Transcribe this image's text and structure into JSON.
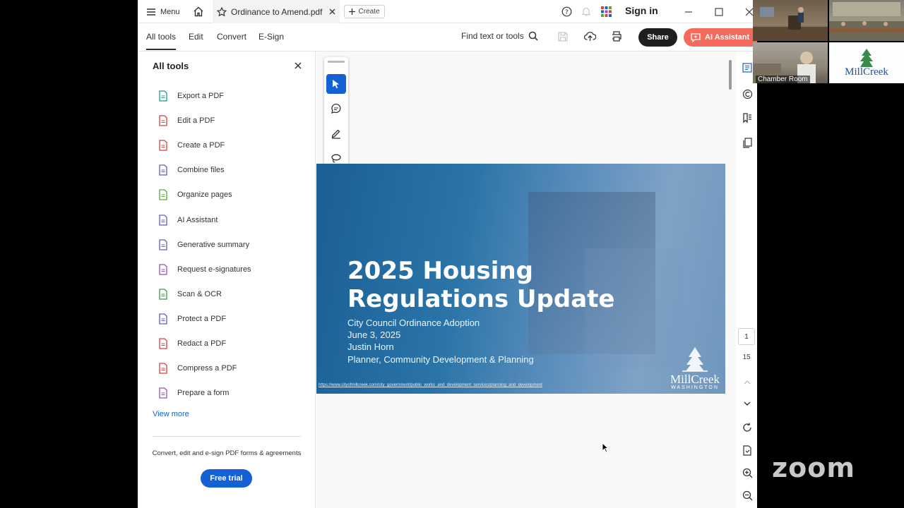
{
  "titlebar": {
    "menu_label": "Menu",
    "tab_title": "Ordinance to Amend.pdf",
    "create_label": "Create",
    "sign_in": "Sign in"
  },
  "toolbar": {
    "tabs": [
      {
        "label": "All tools"
      },
      {
        "label": "Edit"
      },
      {
        "label": "Convert"
      },
      {
        "label": "E-Sign"
      }
    ],
    "find_placeholder": "Find text or tools",
    "share_label": "Share",
    "ai_label": "AI Assistant"
  },
  "panel": {
    "title": "All tools",
    "tools": [
      {
        "label": "Export a PDF",
        "icon": "export-pdf-icon",
        "color": "#1f9a8a"
      },
      {
        "label": "Edit a PDF",
        "icon": "edit-pdf-icon",
        "color": "#d9413a"
      },
      {
        "label": "Create a PDF",
        "icon": "create-pdf-icon",
        "color": "#d9413a"
      },
      {
        "label": "Combine files",
        "icon": "combine-files-icon",
        "color": "#5b5fc7"
      },
      {
        "label": "Organize pages",
        "icon": "organize-pages-icon",
        "color": "#5aa83a"
      },
      {
        "label": "AI Assistant",
        "icon": "ai-assistant-icon",
        "color": "#5b5fc7"
      },
      {
        "label": "Generative summary",
        "icon": "generative-summary-icon",
        "color": "#5b5fc7"
      },
      {
        "label": "Request e-signatures",
        "icon": "request-esignatures-icon",
        "color": "#9b4fb5"
      },
      {
        "label": "Scan & OCR",
        "icon": "scan-ocr-icon",
        "color": "#3a9a4a"
      },
      {
        "label": "Protect a PDF",
        "icon": "protect-pdf-icon",
        "color": "#5b5fc7"
      },
      {
        "label": "Redact a PDF",
        "icon": "redact-pdf-icon",
        "color": "#d9413a"
      },
      {
        "label": "Compress a PDF",
        "icon": "compress-pdf-icon",
        "color": "#d9413a"
      },
      {
        "label": "Prepare a form",
        "icon": "prepare-form-icon",
        "color": "#9b4fb5"
      }
    ],
    "view_more": "View more",
    "promo": "Convert, edit and e-sign PDF forms & agreements",
    "trial_label": "Free trial"
  },
  "slide": {
    "title": "2025 Housing Regulations Update",
    "lines": [
      "City Council Ordinance Adoption",
      "June 3, 2025",
      "Justin Horn",
      "Planner, Community Development & Planning"
    ],
    "url": "https://www.cityofmillcreek.com/city_government/public_works_and_development_services/planning_and_development",
    "logo_main": "MillCreek",
    "logo_sub": "WASHINGTON"
  },
  "pager": {
    "current": "1",
    "total": "15"
  },
  "zoom": {
    "tile_label": "Chamber Room",
    "tile_logo": "MillCreek",
    "brand": "zoom"
  }
}
